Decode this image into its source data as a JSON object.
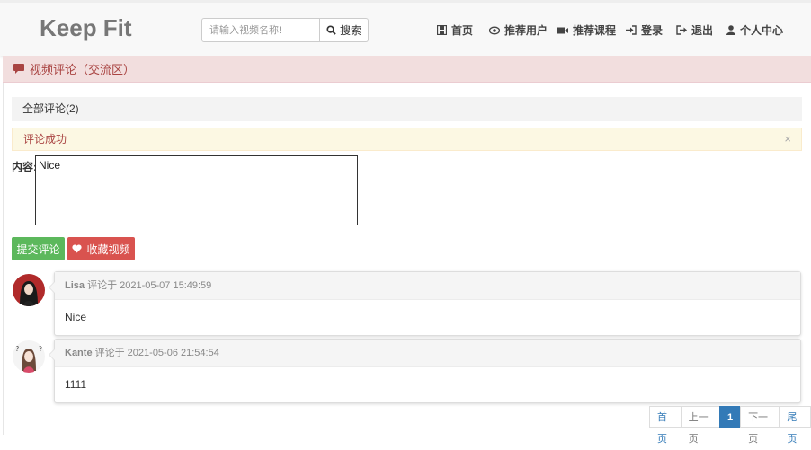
{
  "brand": "Keep Fit",
  "search": {
    "placeholder": "请输入视频名称!",
    "button_label": "搜索"
  },
  "nav": {
    "home": "首页",
    "recommend_users": "推荐用户",
    "recommend_courses": "推荐课程",
    "login": "登录",
    "logout": "退出",
    "profile": "个人中心"
  },
  "panel": {
    "title": "视频评论（交流区）"
  },
  "comments_header": "全部评论(2)",
  "alert": {
    "message": "评论成功",
    "close": "×"
  },
  "form": {
    "content_label": "内容:",
    "content_value": "Nice",
    "submit_label": "提交评论",
    "favorite_label": "收藏视频"
  },
  "comments": [
    {
      "user": "Lisa",
      "meta": "评论于 2021-05-07 15:49:59",
      "text": "Nice"
    },
    {
      "user": "Kante",
      "meta": "评论于 2021-05-06 21:54:54",
      "text": "1111"
    }
  ],
  "pagination": {
    "first": "首页",
    "prev": "上一页",
    "current": "1",
    "next": "下一页",
    "last": "尾页"
  },
  "colors": {
    "success": "#5cb85c",
    "danger": "#d9534f",
    "primary": "#337ab7",
    "panel_bg": "#f2dede",
    "panel_text": "#a94442",
    "alert_bg": "#fcf8e3"
  }
}
